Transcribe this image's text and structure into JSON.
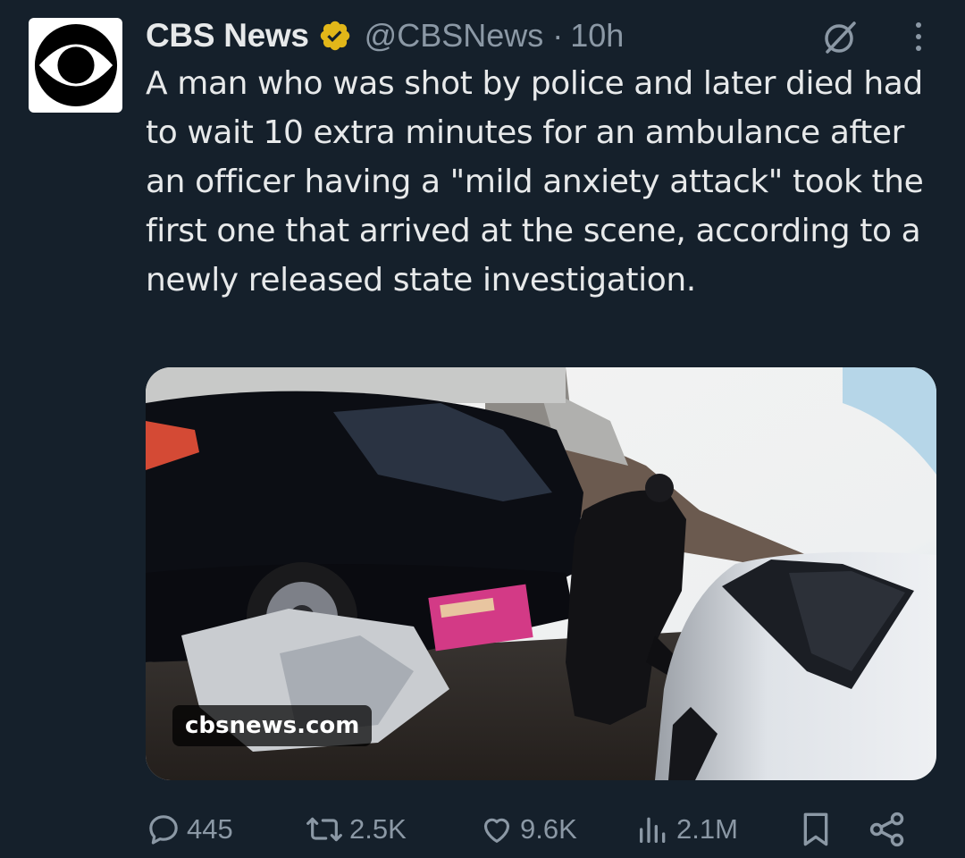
{
  "tweet": {
    "author_name": "CBS News",
    "handle": "@CBSNews",
    "separator": "·",
    "time": "10h",
    "text": "A man who was shot by police and later died had to wait 10 extra minutes for an ambulance after an officer having a \"mild anxiety attack\" took the first one that arrived at the scene, according to a newly released state investigation.",
    "media_source": "cbsnews.com"
  },
  "actions": {
    "replies": "445",
    "reposts": "2.5K",
    "likes": "9.6K",
    "views": "2.1M"
  },
  "icons": {
    "avatar": "cbs-eye-logo",
    "verified": "verified-badge-gold",
    "grok": "grok-icon",
    "more": "more-vertical-icon",
    "reply": "reply-icon",
    "repost": "repost-icon",
    "like": "heart-icon",
    "views": "views-chart-icon",
    "bookmark": "bookmark-icon",
    "share": "share-icon"
  },
  "colors": {
    "background": "#15202b",
    "text": "#e7e9ea",
    "secondary": "#8b98a5",
    "verified_gold": "#e2b719"
  }
}
